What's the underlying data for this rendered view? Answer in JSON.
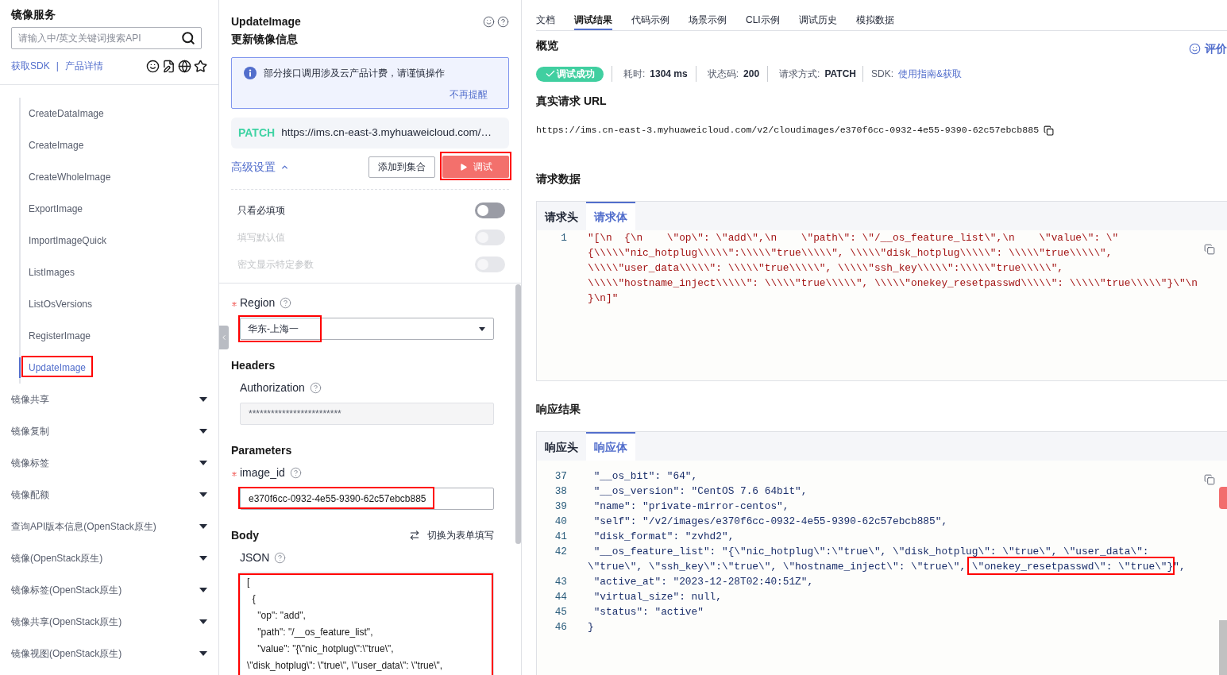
{
  "sidebar": {
    "title": "镜像服务",
    "search": {
      "placeholder": "请输入中/英文关键词搜索API"
    },
    "links": [
      "获取SDK",
      "产品详情"
    ],
    "separator": "|",
    "operations": [
      {
        "label": "CreateDataImage",
        "selected": false,
        "highlighted": false
      },
      {
        "label": "CreateImage",
        "selected": false,
        "highlighted": false
      },
      {
        "label": "CreateWholeImage",
        "selected": false,
        "highlighted": false
      },
      {
        "label": "ExportImage",
        "selected": false,
        "highlighted": false
      },
      {
        "label": "ImportImageQuick",
        "selected": false,
        "highlighted": false
      },
      {
        "label": "ListImages",
        "selected": false,
        "highlighted": false
      },
      {
        "label": "ListOsVersions",
        "selected": false,
        "highlighted": false
      },
      {
        "label": "RegisterImage",
        "selected": false,
        "highlighted": false
      },
      {
        "label": "UpdateImage",
        "selected": true,
        "highlighted": true
      }
    ],
    "groups": [
      {
        "label": "镜像共享",
        "expanded": false
      },
      {
        "label": "镜像复制",
        "expanded": false
      },
      {
        "label": "镜像标签",
        "expanded": false
      },
      {
        "label": "镜像配额",
        "expanded": false
      },
      {
        "label": "查询API版本信息(OpenStack原生)",
        "expanded": false
      },
      {
        "label": "镜像(OpenStack原生)",
        "expanded": false
      },
      {
        "label": "镜像标签(OpenStack原生)",
        "expanded": false
      },
      {
        "label": "镜像共享(OpenStack原生)",
        "expanded": false
      },
      {
        "label": "镜像视图(OpenStack原生)",
        "expanded": false
      }
    ]
  },
  "api_panel": {
    "title": "UpdateImage",
    "subtitle": "更新镜像信息",
    "notice": {
      "text": "部分接口调用涉及云产品计费，请谨慎操作",
      "dismiss": "不再提醒"
    },
    "request": {
      "method": "PATCH",
      "url": "https://ims.cn-east-3.myhuaweicloud.com/…"
    },
    "advanced": {
      "label": "高级设置",
      "expanded": true
    },
    "buttons": [
      {
        "label": "添加到集合",
        "kind": "secondary",
        "highlighted": false
      },
      {
        "label": "调试",
        "kind": "primary",
        "highlighted": true
      }
    ],
    "toggles": [
      {
        "label": "只看必填项",
        "on": false,
        "disabled": false
      },
      {
        "label": "填写默认值",
        "on": false,
        "disabled": true
      },
      {
        "label": "密文显示特定参数",
        "on": false,
        "disabled": true
      }
    ],
    "region": {
      "label": "Region",
      "required": true,
      "value": "华东-上海一",
      "highlighted": true
    },
    "headers": {
      "title": "Headers",
      "fields": [
        {
          "label": "Authorization",
          "required": false,
          "value": "*************************",
          "disabled": true,
          "highlighted": false
        }
      ]
    },
    "parameters": {
      "title": "Parameters",
      "fields": [
        {
          "label": "image_id",
          "required": true,
          "value": "e370f6cc-0932-4e55-9390-62c57ebcb885",
          "disabled": false,
          "highlighted": true
        }
      ]
    },
    "body": {
      "title": "Body",
      "switch_label": "切换为表单填写",
      "format": "JSON",
      "highlighted": true,
      "lines": [
        "[",
        "  {",
        "    \"op\": \"add\",",
        "    \"path\": \"/__os_feature_list\",",
        "    \"value\": \"{\\\"nic_hotplug\\\":\\\"true\\\",",
        "\\\"disk_hotplug\\\": \\\"true\\\", \\\"user_data\\\": \\\"true\\\","
      ]
    }
  },
  "results": {
    "tabs": [
      {
        "label": "文档",
        "selected": false
      },
      {
        "label": "调试结果",
        "selected": true
      },
      {
        "label": "代码示例",
        "selected": false
      },
      {
        "label": "场景示例",
        "selected": false
      },
      {
        "label": "CLI示例",
        "selected": false
      },
      {
        "label": "调试历史",
        "selected": false
      },
      {
        "label": "模拟数据",
        "selected": false
      }
    ],
    "overview": {
      "title": "概览",
      "feedback": "评价",
      "status": "调试成功",
      "stats": [
        {
          "label": "耗时:",
          "value": "1304 ms"
        },
        {
          "label": "状态码:",
          "value": "200"
        },
        {
          "label": "请求方式:",
          "value": "PATCH"
        }
      ],
      "sdk": {
        "label": "SDK:",
        "link": "使用指南&获取"
      }
    },
    "real_url": {
      "title": "真实请求 URL",
      "url": "https://ims.cn-east-3.myhuaweicloud.com/v2/cloudimages/e370f6cc-0932-4e55-9390-62c57ebcb885"
    },
    "request_data": {
      "title": "请求数据",
      "tabs": [
        {
          "label": "请求头",
          "selected": false
        },
        {
          "label": "请求体",
          "selected": true
        }
      ],
      "lines": [
        {
          "number": "1",
          "rows": [
            [
              {
                "text": "\"[\\n  {\\n    \\\"op\\\": \\\"add\\\",\\n    \\\"path\\\": \\\"/__os_feature_list\\\",\\n    \\\"value\\\": \\\"",
                "highlighted": false
              }
            ],
            [
              {
                "text": "{\\\\\\\\\\\"nic_hotplug\\\\\\\\\\\":\\\\\\\\\\\"true\\\\\\\\\\\", \\\\\\\\\\\"disk_hotplug\\\\\\\\\\\": \\\\\\\\\\\"true\\\\\\\\\\\",",
                "highlighted": false
              }
            ],
            [
              {
                "text": "\\\\\\\\\\\"user_data\\\\\\\\\\\": \\\\\\\\\\\"true\\\\\\\\\\\", \\\\\\\\\\\"ssh_key\\\\\\\\\\\":\\\\\\\\\\\"true\\\\\\\\\\\",",
                "highlighted": false
              }
            ],
            [
              {
                "text": "\\\\\\\\\\\"hostname_inject\\\\\\\\\\\": \\\\\\\\\\\"true\\\\\\\\\\\", \\\\\\\\\\\"onekey_resetpasswd\\\\\\\\\\\": \\\\\\\\\\\"true\\\\\\\\\\\"}\\\"\\n",
                "highlighted": false
              }
            ],
            [
              {
                "text": "}\\n]\"",
                "highlighted": false
              }
            ]
          ]
        }
      ]
    },
    "response": {
      "title": "响应结果",
      "tabs": [
        {
          "label": "响应头",
          "selected": false
        },
        {
          "label": "响应体",
          "selected": true
        }
      ],
      "lines": [
        {
          "number": "37",
          "rows": [
            [
              {
                "text": " \"__os_bit\": \"64\",",
                "highlighted": false
              }
            ]
          ]
        },
        {
          "number": "38",
          "rows": [
            [
              {
                "text": " \"__os_version\": \"CentOS 7.6 64bit\",",
                "highlighted": false
              }
            ]
          ]
        },
        {
          "number": "39",
          "rows": [
            [
              {
                "text": " \"name\": \"private-mirror-centos\",",
                "highlighted": false
              }
            ]
          ]
        },
        {
          "number": "40",
          "rows": [
            [
              {
                "text": " \"self\": \"/v2/images/e370f6cc-0932-4e55-9390-62c57ebcb885\",",
                "highlighted": false
              }
            ]
          ]
        },
        {
          "number": "41",
          "rows": [
            [
              {
                "text": " \"disk_format\": \"zvhd2\",",
                "highlighted": false
              }
            ]
          ]
        },
        {
          "number": "42",
          "rows": [
            [
              {
                "text": " \"__os_feature_list\": \"{\\\"nic_hotplug\\\":\\\"true\\\", \\\"disk_hotplug\\\": \\\"true\\\", \\\"user_data\\\":",
                "highlighted": false
              }
            ],
            [
              {
                "text": "\\\"true\\\", \\\"ssh_key\\\":\\\"true\\\", \\\"hostname_inject\\\": \\\"true\\\", ",
                "highlighted": false
              },
              {
                "text": "\\\"onekey_resetpasswd\\\": \\\"true\\\"}",
                "highlighted": true
              },
              {
                "text": "\",",
                "highlighted": false
              }
            ]
          ]
        },
        {
          "number": "43",
          "rows": [
            [
              {
                "text": " \"active_at\": \"2023-12-28T02:40:51Z\",",
                "highlighted": false
              }
            ]
          ]
        },
        {
          "number": "44",
          "rows": [
            [
              {
                "text": " \"virtual_size\": null,",
                "highlighted": false
              }
            ]
          ]
        },
        {
          "number": "45",
          "rows": [
            [
              {
                "text": " \"status\": \"active\"",
                "highlighted": false
              }
            ]
          ]
        },
        {
          "number": "46",
          "rows": [
            [
              {
                "text": "}",
                "highlighted": false
              }
            ]
          ]
        }
      ]
    }
  }
}
